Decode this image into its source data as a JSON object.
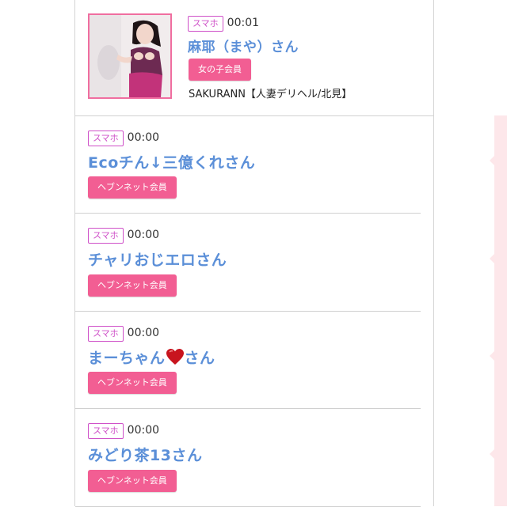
{
  "accent_pink": "#f25e93",
  "tag_purple": "#cf50c8",
  "name_blue": "#5b8fd8",
  "items": [
    {
      "device": "スマホ",
      "time": "00:01",
      "name": "麻耶（まや）さん",
      "badge": "女の子会員",
      "shop": "SAKURANN【人妻デリヘル/北見】"
    },
    {
      "device": "スマホ",
      "time": "00:00",
      "name": "Ecoチん↓三億くれさん",
      "badge": "ヘブンネット会員"
    },
    {
      "device": "スマホ",
      "time": "00:00",
      "name": "チャリおじエロさん",
      "badge": "ヘブンネット会員"
    },
    {
      "device": "スマホ",
      "time": "00:00",
      "name_before": "まーちゃん",
      "name_icon": "heart-icon",
      "name_after": "さん",
      "badge": "ヘブンネット会員"
    },
    {
      "device": "スマホ",
      "time": "00:00",
      "name": "みどり茶13さん",
      "badge": "ヘブンネット会員"
    }
  ]
}
